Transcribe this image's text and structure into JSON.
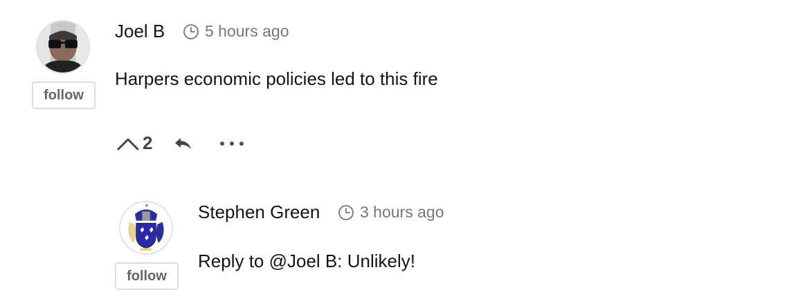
{
  "comments": [
    {
      "author": "Joel B",
      "time": "5 hours ago",
      "text": "Harpers economic policies led to this fire",
      "follow_label": "follow",
      "upvotes": "2"
    },
    {
      "author": "Stephen Green",
      "time": "3 hours ago",
      "text": "Reply to @Joel B: Unlikely!",
      "follow_label": "follow"
    }
  ],
  "colors": {
    "text": "#141414",
    "muted": "#777777",
    "button_border": "#dcdcdc"
  },
  "icons": [
    "clock-icon",
    "upvote-chevron-icon",
    "reply-arrow-icon",
    "more-dots-icon"
  ]
}
